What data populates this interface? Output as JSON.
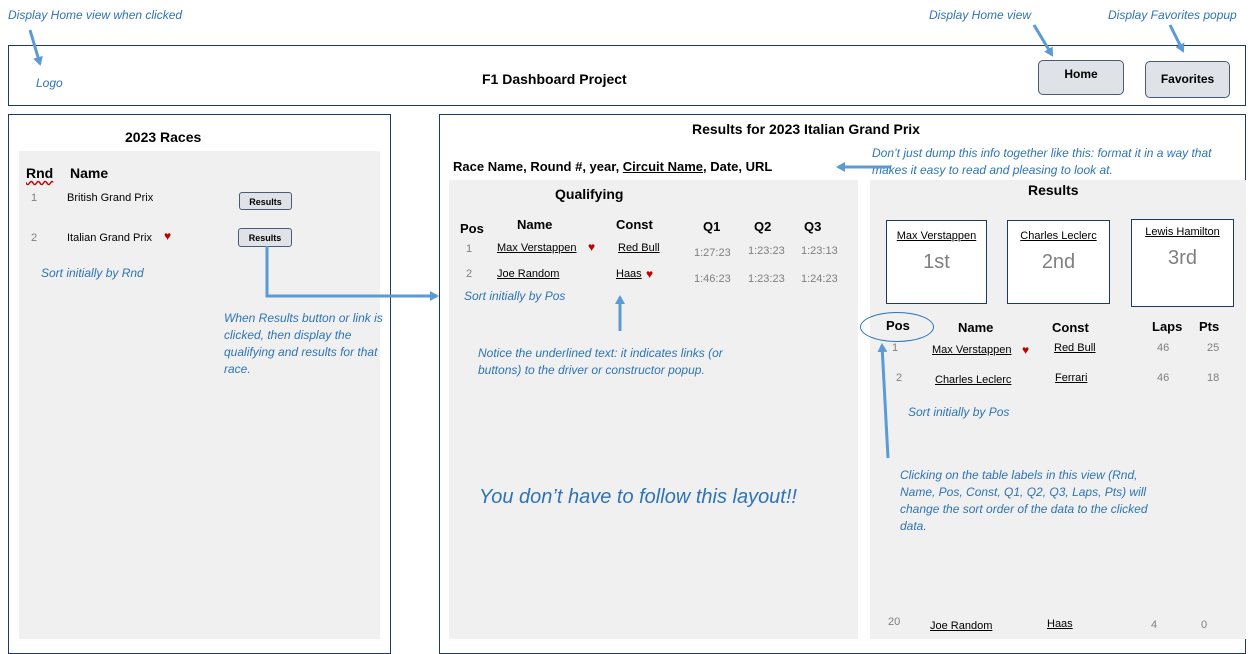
{
  "annotations": {
    "logo_note": "Display Home view when clicked",
    "home_note": "Display Home view",
    "favorites_note": "Display Favorites popup",
    "sort_rnd": "Sort initially by Rnd",
    "results_click_note": "When Results button or link is clicked, then display the qualifying and results for that race.",
    "qual_sort": "Sort initially by Pos",
    "underline_note": "Notice the underlined text: it indicates links (or buttons) to the driver or constructor popup.",
    "layout_note": "You don’t have to follow this layout!!",
    "format_note": "Don’t just dump this info together like this: format it in a way that makes it easy to read and pleasing to look at.",
    "results_sort": "Sort initially by Pos",
    "table_labels_note": "Clicking on the table labels in this view (Rnd, Name, Pos, Const, Q1, Q2, Q3, Laps, Pts) will change the sort order of the data to the clicked data."
  },
  "header": {
    "logo": "Logo",
    "title": "F1 Dashboard Project",
    "home_button": "Home",
    "favorites_button": "Favorites"
  },
  "races": {
    "title": "2023 Races",
    "col_rnd": "Rnd",
    "col_name": "Name",
    "rows": [
      {
        "rnd": "1",
        "name": "British Grand Prix",
        "button": "Results"
      },
      {
        "rnd": "2",
        "name": "Italian Grand Prix",
        "button": "Results"
      }
    ]
  },
  "results_panel": {
    "title": "Results for 2023 Italian Grand Prix",
    "info_prefix": "Race Name, Round #, year, ",
    "info_circuit": "Circuit Name",
    "info_suffix": ", Date, URL"
  },
  "qualifying": {
    "title": "Qualifying",
    "headers": {
      "pos": "Pos",
      "name": "Name",
      "const": "Const",
      "q1": "Q1",
      "q2": "Q2",
      "q3": "Q3"
    },
    "rows": [
      {
        "pos": "1",
        "name": "Max Verstappen",
        "const": "Red Bull",
        "q1": "1:27:23",
        "q2": "1:23:23",
        "q3": "1:23:13"
      },
      {
        "pos": "2",
        "name": "Joe Random",
        "const": "Haas",
        "q1": "1:46:23",
        "q2": "1:23:23",
        "q3": "1:24:23"
      }
    ]
  },
  "results": {
    "title": "Results",
    "podium": [
      {
        "name": "Max Verstappen",
        "place": "1st"
      },
      {
        "name": "Charles Leclerc",
        "place": "2nd"
      },
      {
        "name": "Lewis Hamilton",
        "place": "3rd"
      }
    ],
    "headers": {
      "pos": "Pos",
      "name": "Name",
      "const": "Const",
      "laps": "Laps",
      "pts": "Pts"
    },
    "rows": [
      {
        "pos": "1",
        "name": "Max Verstappen",
        "const": "Red Bull",
        "laps": "46",
        "pts": "25"
      },
      {
        "pos": "2",
        "name": "Charles Leclerc",
        "const": "Ferrari",
        "laps": "46",
        "pts": "18"
      },
      {
        "pos": "20",
        "name": "Joe Random",
        "const": "Haas",
        "laps": "4",
        "pts": "0"
      }
    ]
  },
  "colors": {
    "annotation": "#2e74b5",
    "heart": "#c00000",
    "border": "#1f3864"
  },
  "icons": {
    "favorite": "heart-icon",
    "pointer": "arrow-icon"
  }
}
